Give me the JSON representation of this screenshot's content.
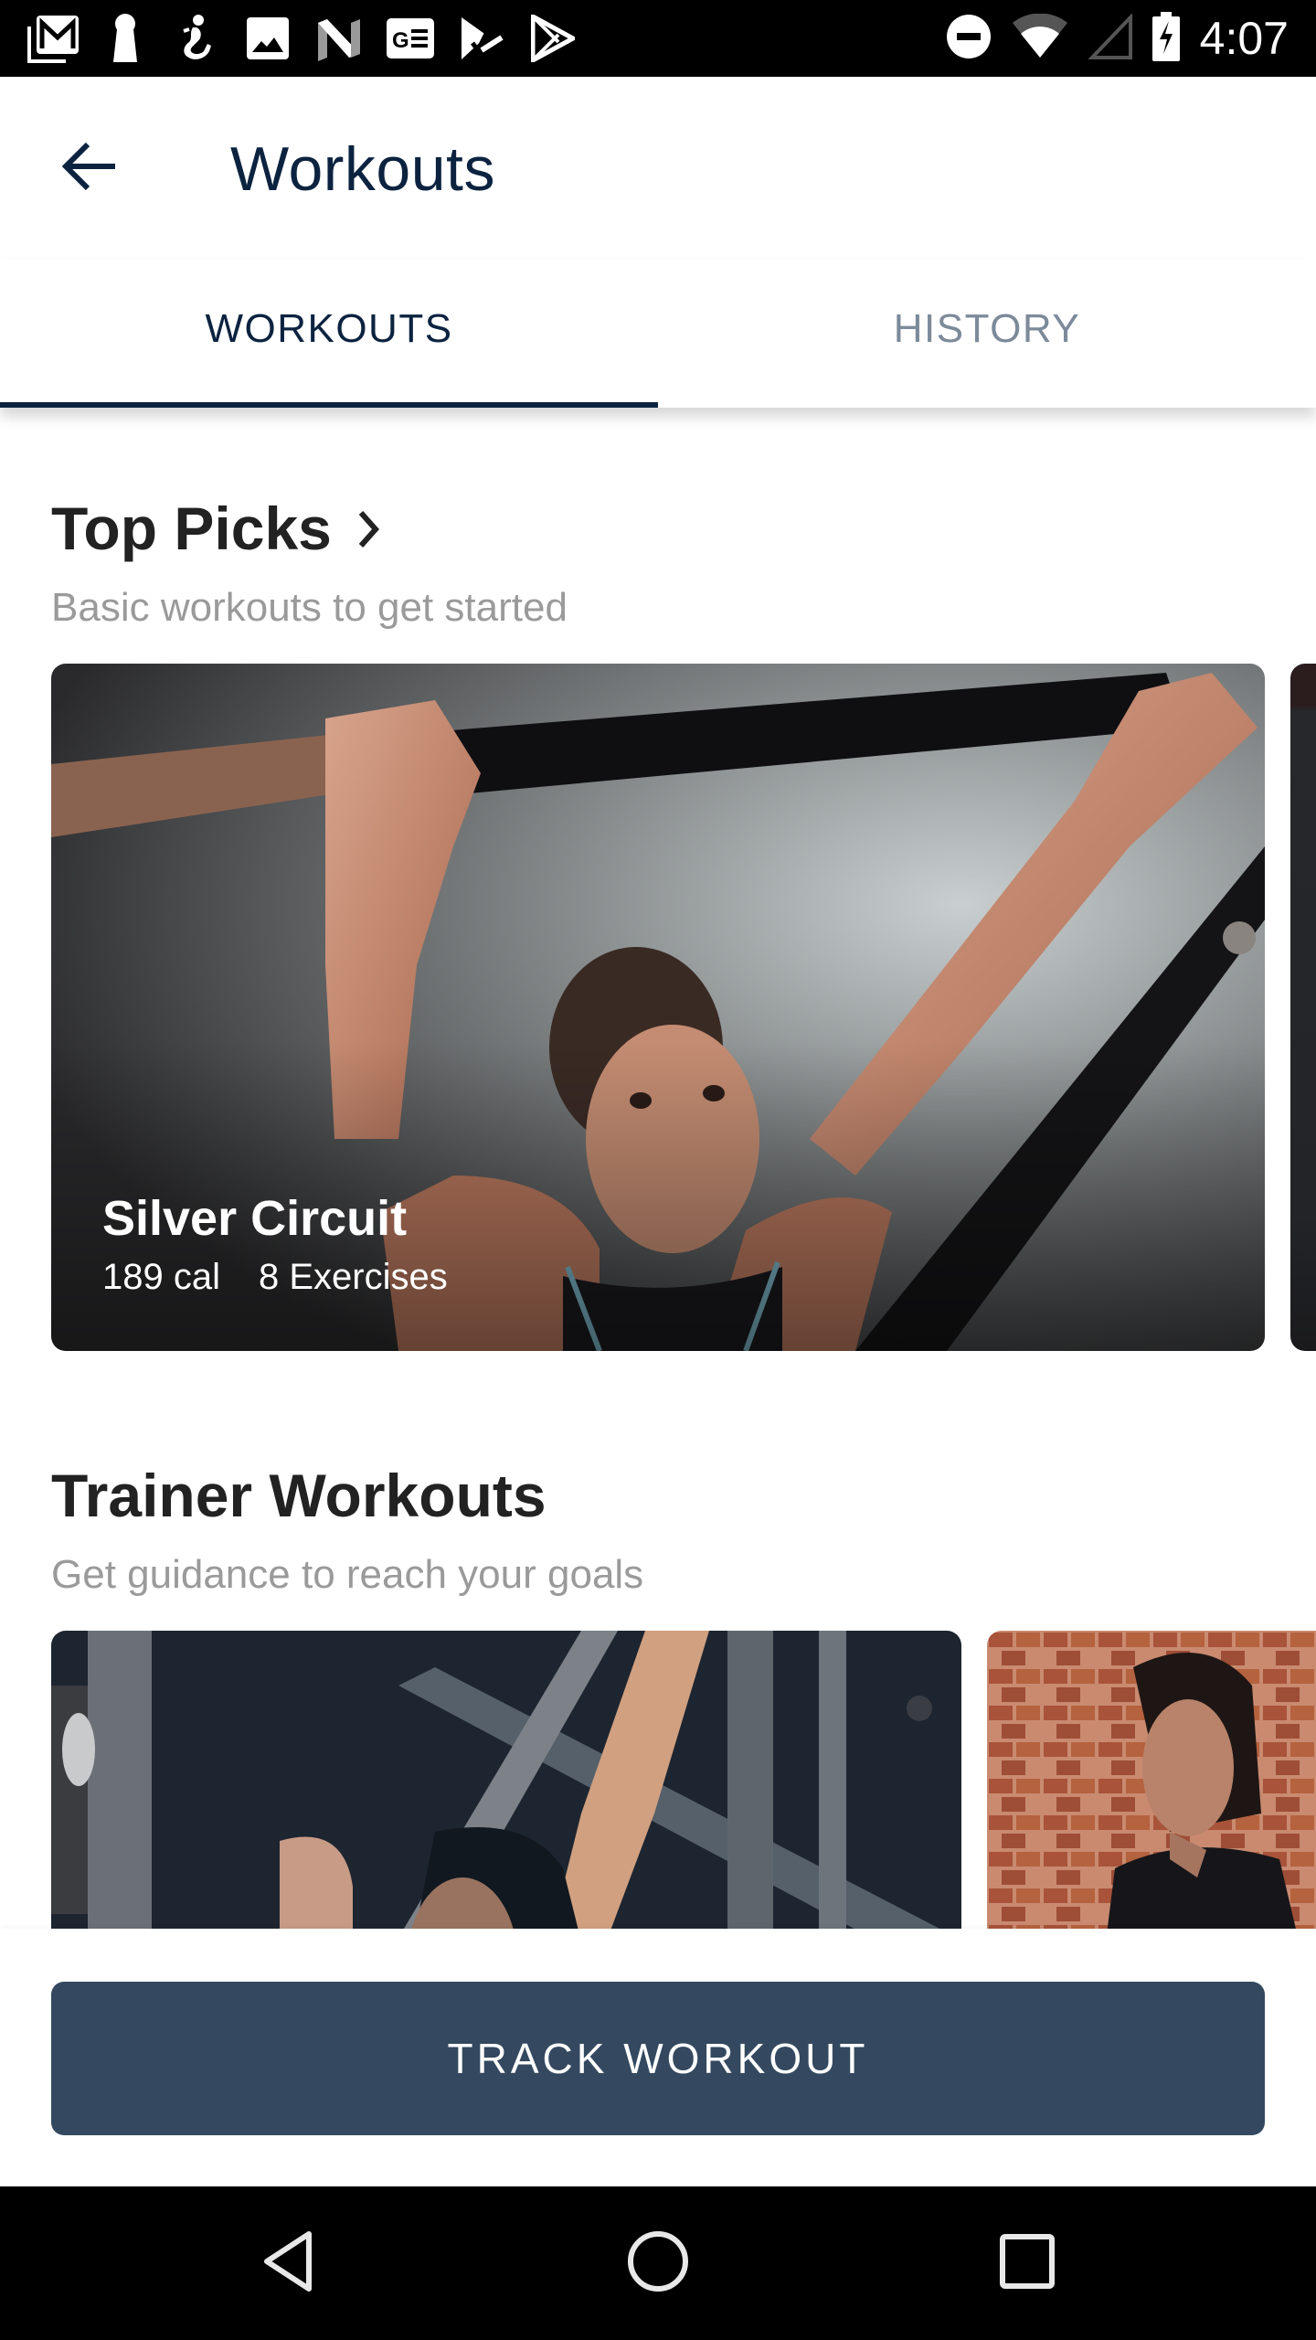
{
  "status_bar": {
    "notification_icons": [
      "gmail-icon",
      "keyhole-icon",
      "fitness-figure-icon",
      "photos-icon",
      "n-logo-icon",
      "news-icon",
      "task-check-icon",
      "play-store-icon"
    ],
    "system_icons": [
      "do-not-disturb-icon",
      "wifi-icon",
      "cell-signal-icon",
      "battery-charging-icon"
    ],
    "time": "4:07"
  },
  "app_bar": {
    "back_icon": "arrow-left-icon",
    "title": "Workouts"
  },
  "tabs": [
    {
      "label": "WORKOUTS",
      "active": true
    },
    {
      "label": "HISTORY",
      "active": false
    }
  ],
  "sections": [
    {
      "title": "Top Picks",
      "has_chevron": true,
      "subtitle": "Basic workouts to get started",
      "cards": [
        {
          "title": "Silver Circuit",
          "calories": "189 cal",
          "exercises": "8 Exercises",
          "photo": "woman gripping pull-up bar in gym"
        },
        {
          "title": "",
          "photo": "partially visible next card"
        }
      ]
    },
    {
      "title": "Trainer Workouts",
      "has_chevron": false,
      "subtitle": "Get guidance to reach your goals",
      "cards": [
        {
          "photo": "man bench pressing barbell"
        },
        {
          "photo": "woman in black top by brick wall"
        }
      ]
    }
  ],
  "primary_action": {
    "label": "TRACK WORKOUT"
  },
  "nav_bar": {
    "buttons": [
      "back-triangle-icon",
      "home-circle-icon",
      "recents-square-icon"
    ]
  },
  "colors": {
    "primary_navy": "#0c2340",
    "button_bg": "#34495f",
    "tab_inactive": "#7c8a9a",
    "subtitle_gray": "#9a9a9a"
  }
}
